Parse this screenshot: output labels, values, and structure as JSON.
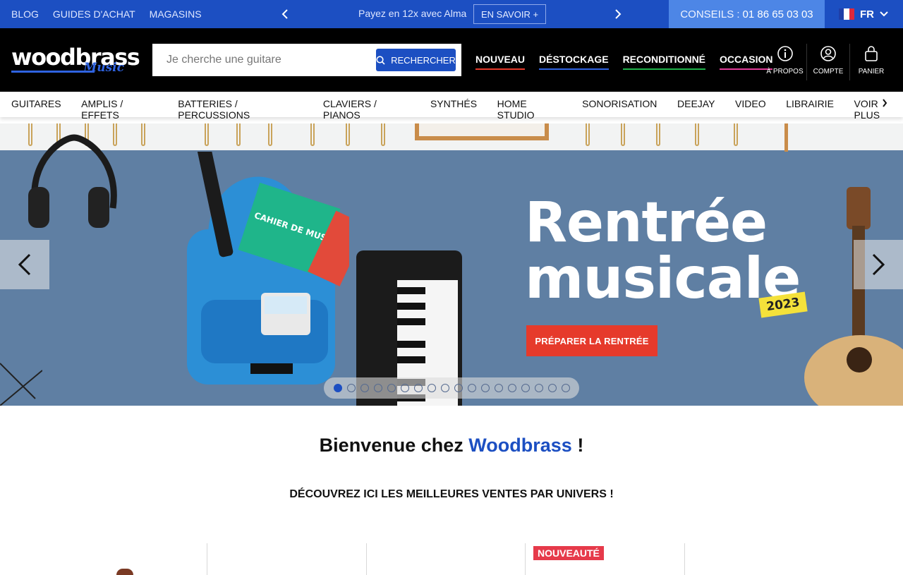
{
  "topbar": {
    "links": [
      "BLOG",
      "GUIDES D'ACHAT",
      "MAGASINS"
    ],
    "promo_text": "Payez en 12x avec Alma",
    "promo_button": "EN SAVOIR +",
    "conseils_label": "CONSEILS :",
    "conseils_phone": "01 86 65 03 03",
    "language": "FR"
  },
  "header": {
    "logo_text": "woodbrass",
    "logo_sub": "Music",
    "search": {
      "placeholder": "Je cherche une guitare",
      "button": "RECHERCHER"
    },
    "nav": [
      {
        "label": "NOUVEAU",
        "color": "#e63a2b"
      },
      {
        "label": "DÉSTOCKAGE",
        "color": "#2f63e0"
      },
      {
        "label": "RECONDITIONNÉ",
        "color": "#1fb24a"
      },
      {
        "label": "OCCASION",
        "color": "#e23c9a"
      }
    ],
    "icons": [
      {
        "name": "info-icon",
        "label": "À PROPOS"
      },
      {
        "name": "account-icon",
        "label": "COMPTE"
      },
      {
        "name": "bag-icon",
        "label": "PANIER"
      }
    ]
  },
  "categories": [
    "GUITARES",
    "AMPLIS / EFFETS",
    "BATTERIES / PERCUSSIONS",
    "CLAVIERS / PIANOS",
    "SYNTHÉS",
    "HOME STUDIO",
    "SONORISATION",
    "DEEJAY",
    "VIDEO",
    "LIBRAIRIE",
    "VOIR PLUS"
  ],
  "hero": {
    "title_line1": "Rentrée",
    "title_line2": "musicale",
    "year": "2023",
    "cta": "PRÉPARER LA RENTRÉE",
    "notebook_text": "CAHIER DE MUSIQUE",
    "slides_count": 18,
    "active_slide": 1
  },
  "welcome": {
    "prefix": "Bienvenue chez",
    "brand": "Woodbrass",
    "suffix": "!"
  },
  "subtitle": "DÉCOUVREZ ICI LES MEILLEURES VENTES PAR UNIVERS !",
  "products": {
    "badge": "NOUVEAUTÉ"
  },
  "colors": {
    "brand_blue": "#1c4fc2",
    "accent_red": "#e63a2b"
  }
}
